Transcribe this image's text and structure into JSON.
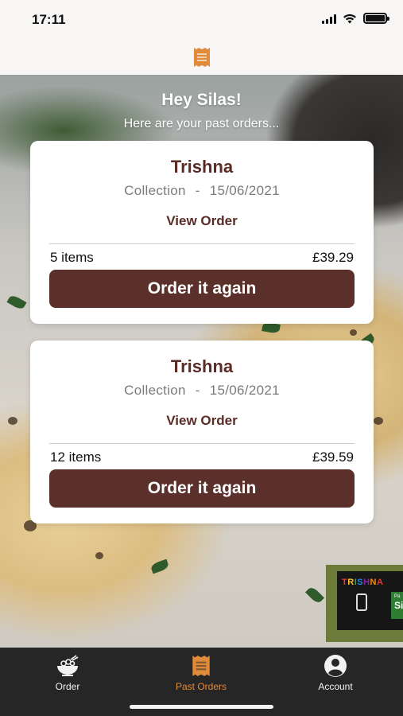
{
  "status_bar": {
    "time": "17:11",
    "icons": [
      "signal-icon",
      "wifi-icon",
      "battery-icon"
    ]
  },
  "header": {
    "icon": "receipt-icon",
    "accent_color": "#e08b3b"
  },
  "greeting": {
    "title": "Hey Silas!",
    "subtitle": "Here are your past orders..."
  },
  "orders": [
    {
      "restaurant": "Trishna",
      "type": "Collection",
      "separator": "-",
      "date": "15/06/2021",
      "view_label": "View Order",
      "items": "5 items",
      "price": "£39.29",
      "reorder_label": "Order it again"
    },
    {
      "restaurant": "Trishna",
      "type": "Collection",
      "separator": "-",
      "date": "15/06/2021",
      "view_label": "View Order",
      "items": "12 items",
      "price": "£39.59",
      "reorder_label": "Order it again"
    }
  ],
  "promo": {
    "logo_text": "TRISHNA",
    "tag_small": "Pa",
    "tag_text": "Si"
  },
  "tabs": [
    {
      "label": "Order",
      "icon": "food-bowl-icon",
      "active": false
    },
    {
      "label": "Past Orders",
      "icon": "receipt-icon",
      "active": true
    },
    {
      "label": "Account",
      "icon": "account-icon",
      "active": false
    }
  ],
  "colors": {
    "brand": "#5b302a",
    "title": "#5b2b25",
    "accent": "#e08b3b",
    "tab_bar": "#262626"
  }
}
